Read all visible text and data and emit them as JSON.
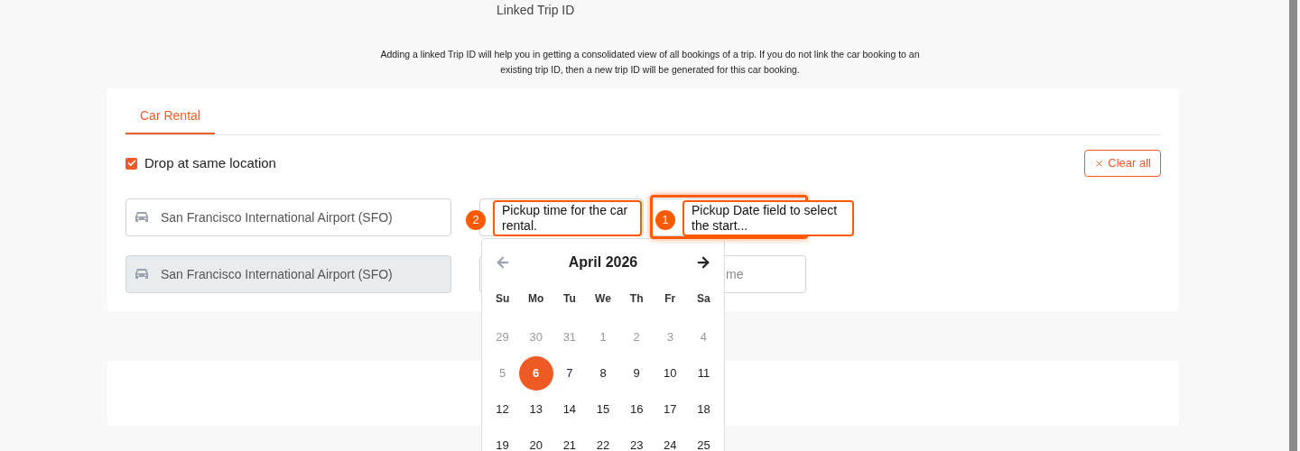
{
  "linked_trip": {
    "label": "Linked Trip ID"
  },
  "info_text": "Adding a linked Trip ID will help you in getting a consolidated view of all bookings of a trip. If you do not link the car booking to an existing trip ID, then a new trip ID will be generated for this car booking.",
  "tabs": [
    {
      "label": "Car Rental",
      "selected": true
    }
  ],
  "same_location": {
    "label": "Drop at same location",
    "checked": true
  },
  "clear_button": {
    "label": "Clear all"
  },
  "pickup_location": {
    "value": "San Francisco International Airport (SFO)",
    "disabled": false
  },
  "drop_location": {
    "value": "San Francisco International Airport (SFO)",
    "disabled": true
  },
  "drop_time": {
    "placeholder": "me"
  },
  "calendar": {
    "month": "April 2026",
    "prev_disabled": true,
    "weekdays": [
      "Su",
      "Mo",
      "Tu",
      "We",
      "Th",
      "Fr",
      "Sa"
    ],
    "weeks": [
      [
        {
          "day": "29",
          "disabled": true,
          "selected": false
        },
        {
          "day": "30",
          "disabled": true,
          "selected": false
        },
        {
          "day": "31",
          "disabled": true,
          "selected": false
        },
        {
          "day": "1",
          "disabled": true,
          "selected": false
        },
        {
          "day": "2",
          "disabled": true,
          "selected": false
        },
        {
          "day": "3",
          "disabled": true,
          "selected": false
        },
        {
          "day": "4",
          "disabled": true,
          "selected": false
        }
      ],
      [
        {
          "day": "5",
          "disabled": true,
          "selected": false
        },
        {
          "day": "6",
          "disabled": false,
          "selected": true
        },
        {
          "day": "7",
          "disabled": false,
          "selected": false
        },
        {
          "day": "8",
          "disabled": false,
          "selected": false
        },
        {
          "day": "9",
          "disabled": false,
          "selected": false
        },
        {
          "day": "10",
          "disabled": false,
          "selected": false
        },
        {
          "day": "11",
          "disabled": false,
          "selected": false
        }
      ],
      [
        {
          "day": "12",
          "disabled": false,
          "selected": false
        },
        {
          "day": "13",
          "disabled": false,
          "selected": false
        },
        {
          "day": "14",
          "disabled": false,
          "selected": false
        },
        {
          "day": "15",
          "disabled": false,
          "selected": false
        },
        {
          "day": "16",
          "disabled": false,
          "selected": false
        },
        {
          "day": "17",
          "disabled": false,
          "selected": false
        },
        {
          "day": "18",
          "disabled": false,
          "selected": false
        }
      ],
      [
        {
          "day": "19",
          "disabled": false,
          "selected": false
        },
        {
          "day": "20",
          "disabled": false,
          "selected": false
        },
        {
          "day": "21",
          "disabled": false,
          "selected": false
        },
        {
          "day": "22",
          "disabled": false,
          "selected": false
        },
        {
          "day": "23",
          "disabled": false,
          "selected": false
        },
        {
          "day": "24",
          "disabled": false,
          "selected": false
        },
        {
          "day": "25",
          "disabled": false,
          "selected": false
        }
      ]
    ]
  },
  "callouts": [
    {
      "number": "2",
      "text": "Pickup time for the car rental.",
      "highlight": false
    },
    {
      "number": "1",
      "text": "Pickup Date field to select the start...",
      "highlight": true
    }
  ]
}
